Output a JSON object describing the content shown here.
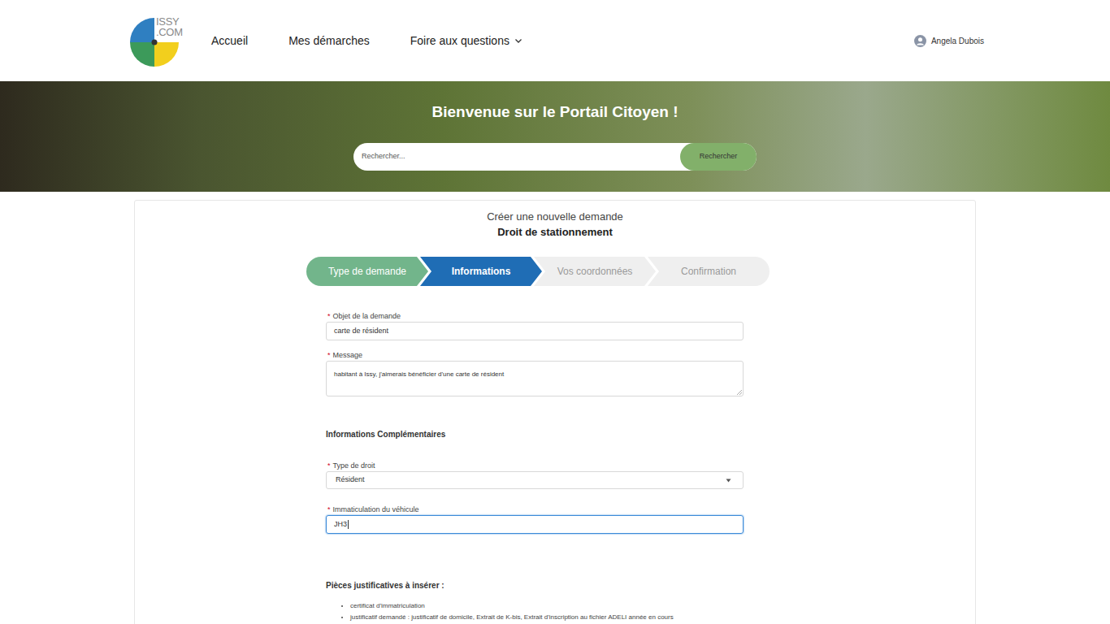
{
  "header": {
    "logo": {
      "line1": "ISSY",
      "line2": ".COM"
    },
    "nav": [
      {
        "label": "Accueil",
        "has_menu": false
      },
      {
        "label": "Mes démarches",
        "has_menu": false
      },
      {
        "label": "Foire aux questions",
        "has_menu": true
      }
    ],
    "user": "Angela Dubois"
  },
  "banner": {
    "title": "Bienvenue sur le Portail Citoyen !",
    "search": {
      "placeholder": "Rechercher...",
      "button": "Rechercher"
    }
  },
  "form": {
    "title": "Créer une nouvelle demande",
    "subtitle": "Droit de stationnement",
    "steps": [
      {
        "label": "Type de demande",
        "done": true,
        "selected": false
      },
      {
        "label": "Informations",
        "done": false,
        "selected": true
      },
      {
        "label": "Vos coordonnées",
        "done": false,
        "selected": false
      },
      {
        "label": "Confirmation",
        "done": false,
        "selected": false
      }
    ],
    "fields": [
      {
        "mark": "*",
        "label": "Objet de la demande",
        "kind": "input",
        "value": "carte de résident",
        "focused": false
      },
      {
        "mark": "*",
        "label": "Message",
        "kind": "textarea",
        "value": "habitant à Issy, j'aimerais bénéficier d'une carte de résident",
        "focused": false
      }
    ],
    "section": "Informations Complémentaires",
    "extra_fields": [
      {
        "mark": "*",
        "label": "Type de droit",
        "kind": "select",
        "value": "Résident",
        "focused": false
      },
      {
        "mark": "*",
        "label": "Immaticulation du véhicule",
        "kind": "input",
        "value": "JH3",
        "focused": true
      }
    ],
    "documents": {
      "title": "Pièces justificatives à insérer :",
      "items": [
        "certificat d'immatriculation",
        "justificatif demandé : justificatif de domicile, Extrait de K-bis, Extrait d'inscription au fichier ADELI année en cours"
      ]
    }
  }
}
